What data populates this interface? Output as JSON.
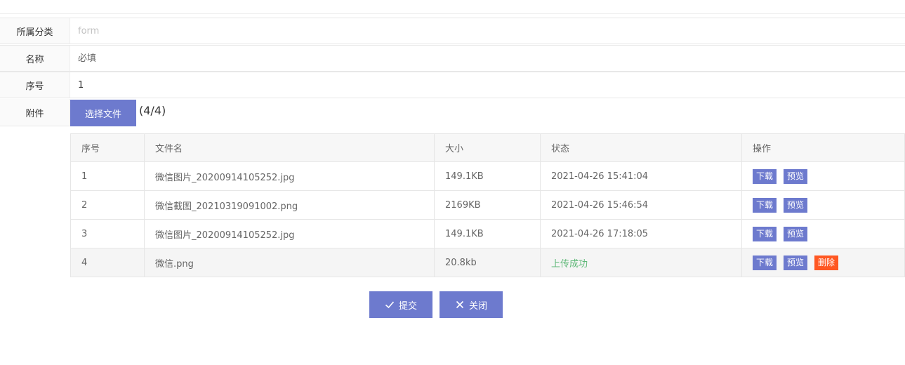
{
  "form": {
    "category": {
      "label": "所属分类",
      "placeholder": "form"
    },
    "name": {
      "label": "名称",
      "placeholder": "必填"
    },
    "sequence": {
      "label": "序号",
      "value": "1"
    },
    "attachment": {
      "label": "附件",
      "choose_button": "选择文件",
      "count": "(4/4)"
    }
  },
  "table": {
    "headers": [
      "序号",
      "文件名",
      "大小",
      "状态",
      "操作"
    ],
    "rows": [
      {
        "idx": "1",
        "name": "微信图片_20200914105252.jpg",
        "size": "149.1KB",
        "status": "2021-04-26 15:41:04"
      },
      {
        "idx": "2",
        "name": "微信截图_20210319091002.png",
        "size": "2169KB",
        "status": "2021-04-26 15:46:54"
      },
      {
        "idx": "3",
        "name": "微信图片_20200914105252.jpg",
        "size": "149.1KB",
        "status": "2021-04-26 17:18:05"
      },
      {
        "idx": "4",
        "name": "微信.png",
        "size": "20.8kb",
        "status": "上传成功"
      }
    ],
    "actions": {
      "download": "下载",
      "preview": "预览",
      "delete": "删除"
    }
  },
  "buttons": {
    "submit": "提交",
    "close": "关闭"
  },
  "colors": {
    "accent": "#6d7ace",
    "danger": "#ff5722",
    "success": "#5fb878"
  }
}
